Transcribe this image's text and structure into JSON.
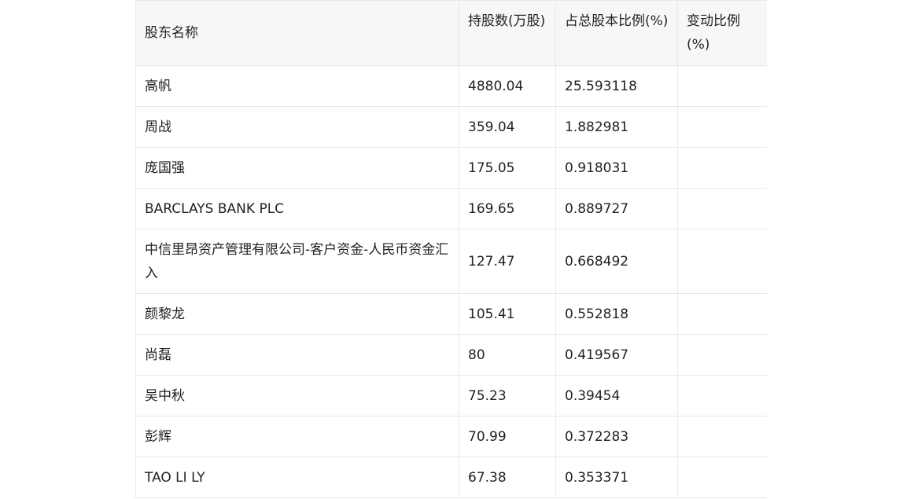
{
  "table": {
    "headers": [
      "股东名称",
      "持股数(万股)",
      "占总股本比例(%)",
      "变动比例(%)"
    ],
    "rows": [
      [
        "高帆",
        "4880.04",
        "25.593118",
        ""
      ],
      [
        "周战",
        "359.04",
        "1.882981",
        ""
      ],
      [
        "庞国强",
        "175.05",
        "0.918031",
        ""
      ],
      [
        "BARCLAYS BANK PLC",
        "169.65",
        "0.889727",
        ""
      ],
      [
        "中信里昂资产管理有限公司-客户资金-人民币资金汇入",
        "127.47",
        "0.668492",
        ""
      ],
      [
        "颜黎龙",
        "105.41",
        "0.552818",
        ""
      ],
      [
        "尚磊",
        "80",
        "0.419567",
        ""
      ],
      [
        "吴中秋",
        "75.23",
        "0.39454",
        ""
      ],
      [
        "彭辉",
        "70.99",
        "0.372283",
        ""
      ],
      [
        "TAO LI LY",
        "67.38",
        "0.353371",
        ""
      ]
    ]
  }
}
